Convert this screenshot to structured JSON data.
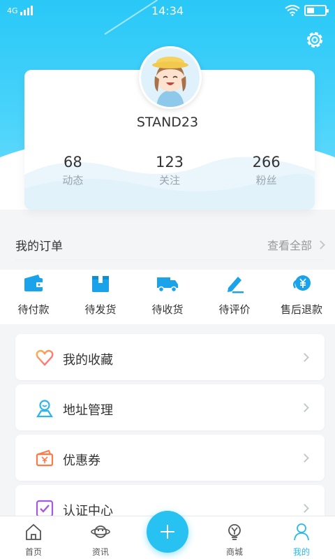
{
  "status_bar": {
    "network": "4G",
    "time": "14:34"
  },
  "profile": {
    "username": "STAND23"
  },
  "stats": [
    {
      "value": "68",
      "label": "动态"
    },
    {
      "value": "123",
      "label": "关注"
    },
    {
      "value": "266",
      "label": "粉丝"
    }
  ],
  "orders": {
    "title": "我的订单",
    "view_all": "查看全部",
    "items": [
      {
        "label": "待付款",
        "icon": "wallet-icon"
      },
      {
        "label": "待发货",
        "icon": "box-icon"
      },
      {
        "label": "待收货",
        "icon": "truck-icon"
      },
      {
        "label": "待评价",
        "icon": "pen-icon"
      },
      {
        "label": "售后退款",
        "icon": "refund-yen-icon"
      }
    ]
  },
  "menu": [
    {
      "label": "我的收藏",
      "icon": "heart-icon"
    },
    {
      "label": "地址管理",
      "icon": "location-icon"
    },
    {
      "label": "优惠券",
      "icon": "coupon-icon"
    },
    {
      "label": "认证中心",
      "icon": "certify-icon"
    }
  ],
  "nav": [
    {
      "label": "首页",
      "icon": "home-icon"
    },
    {
      "label": "资讯",
      "icon": "planet-icon"
    },
    {
      "label": "商城",
      "icon": "bulb-icon"
    },
    {
      "label": "我的",
      "icon": "user-icon"
    }
  ],
  "colors": {
    "accent": "#29c8f7",
    "active": "#29b9ef"
  }
}
